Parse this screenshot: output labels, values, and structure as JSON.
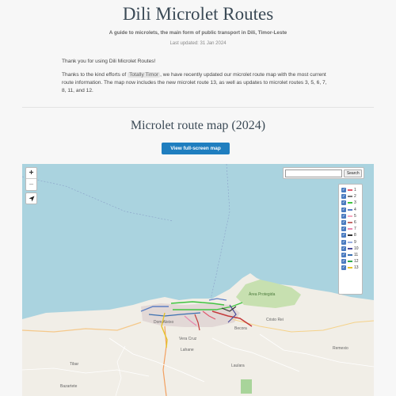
{
  "header": {
    "title": "Dili Microlet Routes",
    "subtitle": "A guide to microlets, the main form of public transport in Dili, Timor-Leste",
    "updated": "Last updated: 31 Jan 2024"
  },
  "intro": {
    "thanks": "Thank you for using Dili Microlet Routes!",
    "p2_before": "Thanks to the kind efforts of ",
    "p2_highlight": "Totally Timor",
    "p2_after": ", we have recently updated our microlet route map with the most current route information. The map now includes the new microlet route 13, as well as updates to microlet routes 3, 5, 6, 7, 8, 11, and 12."
  },
  "map_section": {
    "title": "Microlet route map (2024)",
    "fullscreen_label": "View full-screen map"
  },
  "map": {
    "zoom_in": "+",
    "zoom_out": "−",
    "search_placeholder": "",
    "search_button": "Search",
    "legend": [
      {
        "label": "1",
        "color": "#e05a6d"
      },
      {
        "label": "2",
        "color": "#7a7a7a"
      },
      {
        "label": "3",
        "color": "#41c441"
      },
      {
        "label": "4",
        "color": "#5c7fc4"
      },
      {
        "label": "5",
        "color": "#f2a8c0"
      },
      {
        "label": "6",
        "color": "#c46a6a"
      },
      {
        "label": "7",
        "color": "#e88ab0"
      },
      {
        "label": "8",
        "color": "#333333"
      },
      {
        "label": "9",
        "color": "#9ab0e0"
      },
      {
        "label": "10",
        "color": "#4a4a9a"
      },
      {
        "label": "11",
        "color": "#3a6fb0"
      },
      {
        "label": "12",
        "color": "#2fa84f"
      },
      {
        "label": "13",
        "color": "#e6c32a"
      }
    ],
    "places": {
      "area_protegida": "Área Protegida",
      "cristo_rei": "Cristo Rei",
      "becora": "Becora",
      "vera_cruz": "Vera Cruz",
      "lahane": "Lahane",
      "laulara": "Laulara",
      "remexio": "Remexio",
      "bazartete": "Bazartete",
      "tibar": "Tibar",
      "dom_aleixo": "Dom Aleixo"
    }
  }
}
